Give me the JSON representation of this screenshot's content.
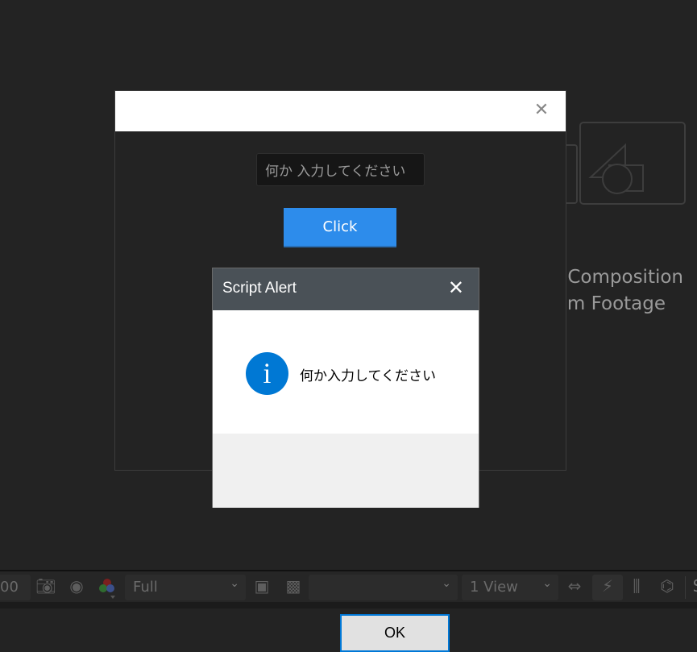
{
  "background": {
    "new_composition_text": "y Composition",
    "from_footage_text": "om Footage"
  },
  "panel": {
    "close_icon": "close-icon",
    "input_value": "何か 入力してください",
    "button_label": "Click"
  },
  "alert": {
    "title": "Script Alert",
    "message": "何か入力してください",
    "icon": "info-icon",
    "icon_glyph": "i",
    "ok_label": "OK",
    "close_glyph": "✕",
    "accent": "#0078d4"
  },
  "toolbar": {
    "magnification_value": "00",
    "resolution": "Full",
    "camera_select": "",
    "view_layout": "1 View",
    "chevron": "⌄",
    "cut_char": "S"
  }
}
